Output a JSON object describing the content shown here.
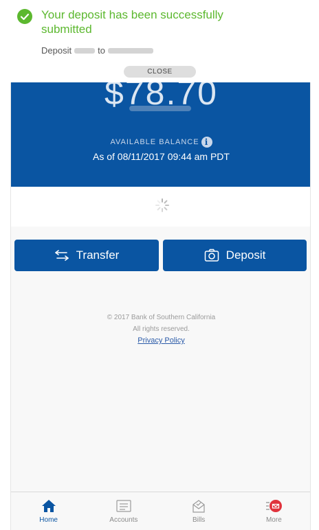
{
  "toast": {
    "message": "Your deposit has been successfully submitted",
    "detail_prefix": "Deposit",
    "detail_to": "to",
    "close_label": "CLOSE"
  },
  "balance": {
    "amount": "$78.70",
    "label": "AVAILABLE BALANCE",
    "info_glyph": "i",
    "as_of": "As of  08/11/2017 09:44 am PDT"
  },
  "actions": {
    "transfer_label": "Transfer",
    "deposit_label": "Deposit"
  },
  "footer": {
    "copyright": "© 2017 Bank of Southern California",
    "rights": "All rights reserved.",
    "privacy": "Privacy Policy"
  },
  "tabs": [
    {
      "label": "Home",
      "icon": "home-icon"
    },
    {
      "label": "Accounts",
      "icon": "accounts-icon"
    },
    {
      "label": "Bills",
      "icon": "bills-icon"
    },
    {
      "label": "More",
      "icon": "more-icon"
    }
  ],
  "colors": {
    "brand_blue": "#0a55a2",
    "success_green": "#5cb82f",
    "alert_red": "#e0323c"
  }
}
